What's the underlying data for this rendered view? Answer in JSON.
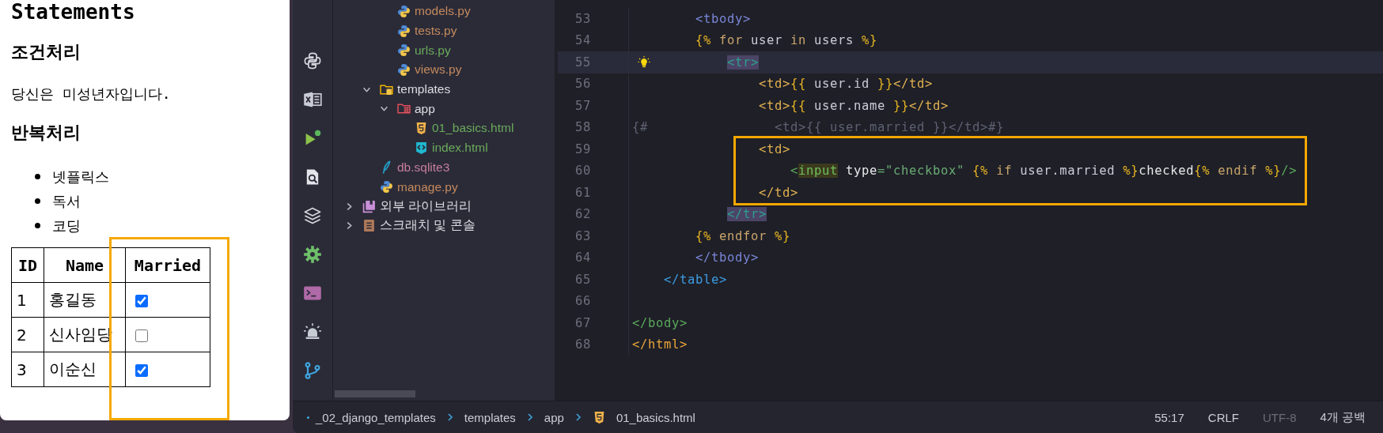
{
  "browser": {
    "heading": "Statements",
    "sections": [
      {
        "title": "조건처리"
      },
      {
        "title": "반복처리"
      }
    ],
    "paragraph": "당신은 미성년자입니다.",
    "list": [
      "넷플릭스",
      "독서",
      "코딩"
    ],
    "table": {
      "columns": [
        "ID",
        "Name",
        "Married"
      ],
      "rows": [
        {
          "id": "1",
          "name": "홍길동",
          "married": true
        },
        {
          "id": "2",
          "name": "신사임당",
          "married": false
        },
        {
          "id": "3",
          "name": "이순신",
          "married": true
        }
      ]
    }
  },
  "project_tree": [
    {
      "kind": "continued",
      "children": [
        {
          "kind": "continued",
          "children": [
            {
              "label": "models.py",
              "kind": "python",
              "color": "#c48a5c"
            },
            {
              "label": "tests.py",
              "kind": "python",
              "color": "#c48a5c"
            },
            {
              "label": "urls.py",
              "kind": "python",
              "color": "#6aab5a"
            },
            {
              "label": "views.py",
              "kind": "python",
              "color": "#c48a5c"
            }
          ]
        },
        {
          "label": "templates",
          "kind": "templates-folder",
          "color": "#dcdde2",
          "expanded": true,
          "children": [
            {
              "label": "app",
              "kind": "package-folder",
              "color": "#dcdde2",
              "expanded": true,
              "children": [
                {
                  "label": "01_basics.html",
                  "kind": "html5",
                  "color": "#6aab5a"
                },
                {
                  "label": "index.html",
                  "kind": "html",
                  "color": "#6aab5a"
                }
              ]
            }
          ]
        },
        {
          "label": "db.sqlite3",
          "kind": "sqlite",
          "color": "#c77d9c"
        },
        {
          "label": "manage.py",
          "kind": "python",
          "color": "#c48a5c"
        }
      ]
    },
    {
      "label": "외부 라이브러리",
      "kind": "library",
      "color": "#dcdde2",
      "expanded": false
    },
    {
      "label": "스크래치 및 콘솔",
      "kind": "scratch",
      "color": "#dcdde2",
      "expanded": false
    }
  ],
  "editor": {
    "lines": [
      {
        "number": "53",
        "segments": [
          {
            "text": "        <tbody>",
            "kind": "section-tag"
          }
        ]
      },
      {
        "number": "54",
        "segments": [
          {
            "text": "        {%",
            "kind": "template"
          },
          {
            "text": " for",
            "kind": "keyword"
          },
          {
            "text": " user",
            "kind": "text"
          },
          {
            "text": " in",
            "kind": "keyword"
          },
          {
            "text": " users",
            "kind": "text"
          },
          {
            "text": " %}",
            "kind": "template"
          }
        ]
      },
      {
        "number": "55",
        "current": true,
        "bulb": true,
        "segments": [
          {
            "text": "            <tr>",
            "kind": "row-tag-matched"
          }
        ]
      },
      {
        "number": "56",
        "segments": [
          {
            "text": "                <td>",
            "kind": "cell-tag"
          },
          {
            "text": "{{",
            "kind": "template"
          },
          {
            "text": " user.id",
            "kind": "text"
          },
          {
            "text": " }}",
            "kind": "template"
          },
          {
            "text": "</td>",
            "kind": "cell-tag"
          }
        ]
      },
      {
        "number": "57",
        "segments": [
          {
            "text": "                <td>",
            "kind": "cell-tag"
          },
          {
            "text": "{{",
            "kind": "template"
          },
          {
            "text": " user.name",
            "kind": "text"
          },
          {
            "text": " }}",
            "kind": "template"
          },
          {
            "text": "</td>",
            "kind": "cell-tag"
          }
        ]
      },
      {
        "number": "58",
        "segments": [
          {
            "text": "{#                <td>{{ user.married }}</td>#}",
            "kind": "comment"
          }
        ]
      },
      {
        "number": "59",
        "segments": [
          {
            "text": "                <td>",
            "kind": "cell-tag"
          }
        ]
      },
      {
        "number": "60",
        "segments": [
          {
            "text": "                    <",
            "kind": "green-tag"
          },
          {
            "text": "input",
            "kind": "input-tag-matched"
          },
          {
            "text": " type",
            "kind": "attr"
          },
          {
            "text": "=\"checkbox\"",
            "kind": "string"
          },
          {
            "text": " {%",
            "kind": "template"
          },
          {
            "text": " if",
            "kind": "keyword"
          },
          {
            "text": " user.married",
            "kind": "text"
          },
          {
            "text": " %}",
            "kind": "template"
          },
          {
            "text": "checked",
            "kind": "attr"
          },
          {
            "text": "{%",
            "kind": "template"
          },
          {
            "text": " endif",
            "kind": "keyword"
          },
          {
            "text": " %}",
            "kind": "template"
          },
          {
            "text": "/>",
            "kind": "green-tag"
          }
        ]
      },
      {
        "number": "61",
        "segments": [
          {
            "text": "                </td>",
            "kind": "cell-tag"
          }
        ]
      },
      {
        "number": "62",
        "segments": [
          {
            "text": "            </tr>",
            "kind": "row-tag-matched"
          }
        ]
      },
      {
        "number": "63",
        "segments": [
          {
            "text": "        {%",
            "kind": "template"
          },
          {
            "text": " endfor",
            "kind": "keyword"
          },
          {
            "text": " %}",
            "kind": "template"
          }
        ]
      },
      {
        "number": "64",
        "segments": [
          {
            "text": "        </tbody>",
            "kind": "section-tag"
          }
        ]
      },
      {
        "number": "65",
        "segments": [
          {
            "text": "    </table>",
            "kind": "table-tag"
          }
        ]
      },
      {
        "number": "66"
      },
      {
        "number": "67",
        "segments": [
          {
            "text": "</body>",
            "kind": "body-tag"
          }
        ]
      },
      {
        "number": "68",
        "segments": [
          {
            "text": "</html>",
            "kind": "html-tag"
          }
        ]
      }
    ]
  },
  "status_bar": {
    "breadcrumbs": [
      {
        "label": "_02_django_templates",
        "kind": "folder"
      },
      {
        "label": "templates",
        "kind": "folder"
      },
      {
        "label": "app",
        "kind": "folder"
      },
      {
        "label": "01_basics.html",
        "kind": "html5"
      }
    ],
    "items": [
      {
        "label": "55:17",
        "disabled": false
      },
      {
        "label": "CRLF",
        "disabled": false
      },
      {
        "label": "UTF-8",
        "disabled": true
      },
      {
        "label": "4개 공백",
        "disabled": false
      }
    ]
  }
}
